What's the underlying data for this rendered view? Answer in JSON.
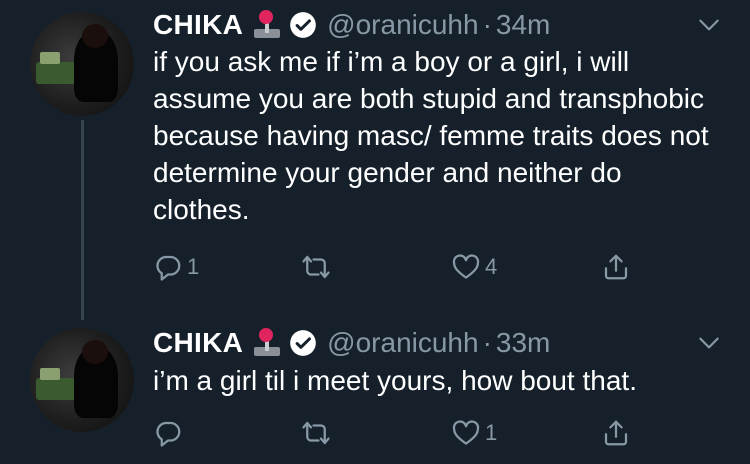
{
  "tweets": [
    {
      "name": "CHIKA",
      "handle": "@oranicuhh",
      "separator": "·",
      "time": "34m",
      "text": "if you ask me if i’m a boy or a girl, i will assume you are both stupid and transphobic because having masc/ femme traits does not determine your gender and neither do clothes.",
      "reply_count": "1",
      "retweet_count": "",
      "like_count": "4",
      "icons": [
        "joystick-icon",
        "verified-icon",
        "chevron-down-icon",
        "reply-icon",
        "retweet-icon",
        "heart-icon",
        "share-icon"
      ]
    },
    {
      "name": "CHIKA",
      "handle": "@oranicuhh",
      "separator": "·",
      "time": "33m",
      "text": "i’m a girl til i meet yours, how bout that.",
      "reply_count": "",
      "retweet_count": "",
      "like_count": "1",
      "icons": [
        "joystick-icon",
        "verified-icon",
        "chevron-down-icon",
        "reply-icon",
        "retweet-icon",
        "heart-icon",
        "share-icon"
      ]
    }
  ],
  "colors": {
    "background": "#15202b",
    "text_primary": "#ffffff",
    "text_secondary": "#8899a6",
    "thread_line": "#38444d"
  }
}
